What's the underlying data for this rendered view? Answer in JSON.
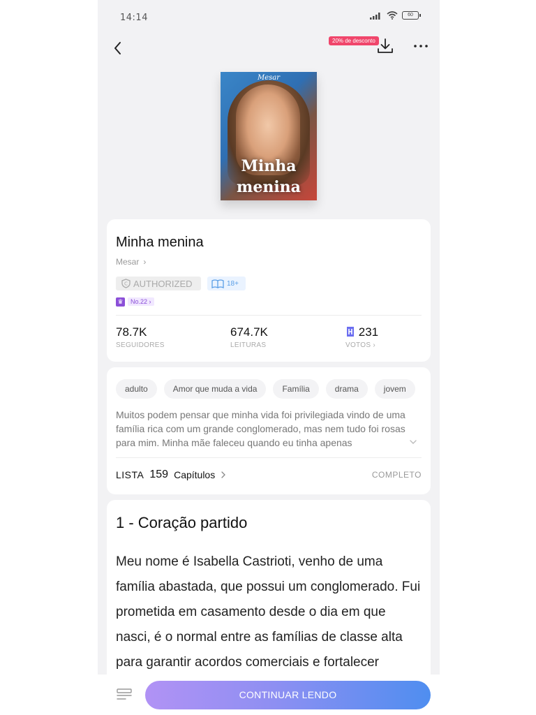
{
  "status_bar": {
    "time": "14:14",
    "battery": "60"
  },
  "header": {
    "discount_badge": "20% de desconto"
  },
  "cover": {
    "author": "Mesar",
    "title": "Minha menina"
  },
  "book": {
    "title": "Minha menina",
    "author": "Mesar",
    "authorized_badge": "AUTHORIZED",
    "age_badge": "18+",
    "rank": "No.22"
  },
  "stats": [
    {
      "value": "78.7K",
      "label": "SEGUIDORES"
    },
    {
      "value": "674.7K",
      "label": "LEITURAS"
    },
    {
      "value": "231",
      "label": "VOTOS"
    }
  ],
  "tags": [
    "adulto",
    "Amor que muda a vida",
    "Família",
    "drama",
    "jovem"
  ],
  "synopsis": "Muitos podem pensar que minha vida foi privilegiada vindo de uma família rica com um grande conglomerado, mas nem tudo foi rosas para mim. Minha mãe faleceu quando eu tinha apenas",
  "chapters_row": {
    "label": "LISTA",
    "count": "159",
    "unit": "Capítulos",
    "status": "COMPLETO"
  },
  "chapter": {
    "title": "1 - Coração partido",
    "text": "Meu nome é Isabella Castrioti, venho de uma família abastada, que possui um conglomerado. Fui prometida em casamento desde o dia em que nasci, é o normal entre as famílias de classe alta para garantir acordos comerciais e fortalecer"
  },
  "bottom": {
    "continue_label": "CONTINUAR LENDO"
  },
  "colors": {
    "accent": "#4f8ef0",
    "discount": "#f0466b",
    "rank": "#8b4fd8"
  }
}
